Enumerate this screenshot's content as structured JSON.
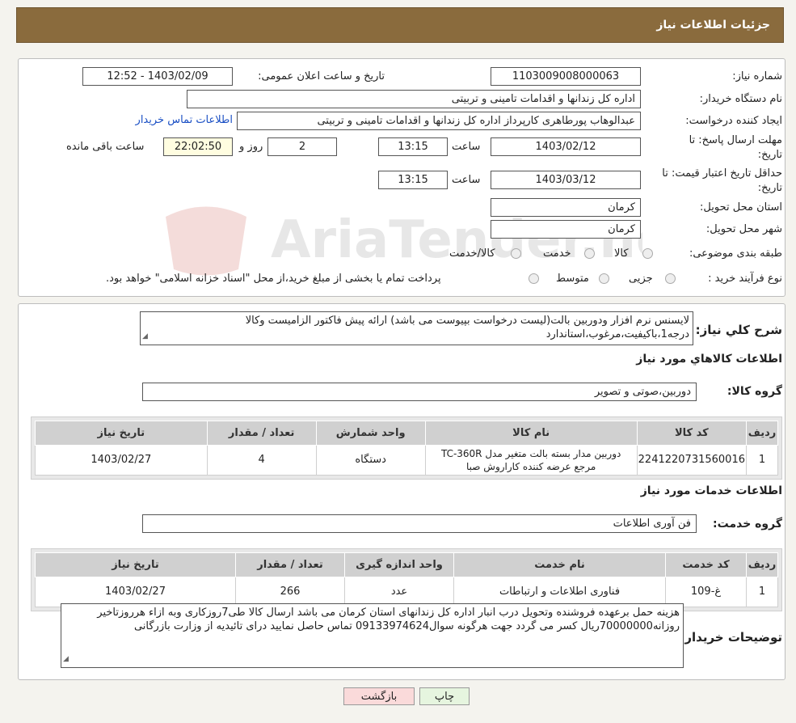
{
  "header": {
    "title": "جزئیات اطلاعات نیاز"
  },
  "form": {
    "need_number_label": "شماره نیاز:",
    "need_number": "1103009008000063",
    "announce_label": "تاریخ و ساعت اعلان عمومی:",
    "announce_value": "1403/02/09 - 12:52",
    "buyer_org_label": "نام دستگاه خریدار:",
    "buyer_org": "اداره کل زندانها و اقدامات تامینی و تربیتی",
    "creator_label": "ایجاد کننده درخواست:",
    "creator": "عبدالوهاب پورطاهری کارپرداز اداره کل زندانها و اقدامات تامینی و تربیتی",
    "contact_link": "اطلاعات تماس خریدار",
    "deadline_label_1": "مهلت ارسال پاسخ: تا",
    "deadline_label_2": "تاریخ:",
    "deadline_date": "1403/02/12",
    "time_label": "ساعت",
    "deadline_time": "13:15",
    "days_value": "2",
    "days_label": "روز و",
    "remaining_value": "22:02:50",
    "remaining_label": "ساعت باقی مانده",
    "validity_label_1": "حداقل تاریخ اعتبار قیمت: تا",
    "validity_label_2": "تاریخ:",
    "validity_date": "1403/03/12",
    "validity_time": "13:15",
    "province_label": "استان محل تحویل:",
    "province": "کرمان",
    "city_label": "شهر محل تحویل:",
    "city": "کرمان",
    "category_label": "طبقه بندی موضوعی:",
    "category_options": [
      "کالا",
      "خدمت",
      "کالا/خدمت"
    ],
    "purchase_type_label": "نوع فرآیند خرید :",
    "purchase_options": [
      "جزیی",
      "متوسط"
    ],
    "purchase_note": "پرداخت تمام یا بخشی از مبلغ خرید،از محل \"اسناد خزانه اسلامی\" خواهد بود."
  },
  "description": {
    "label": "شرح کلي نياز:",
    "text": "لایسنس نرم افزار ودوربین بالت(لیست درخواست بپیوست می باشد) ارائه پیش فاکتور الزامیست وکالا درجه1،باکیفیت،مرغوب،استاندارد"
  },
  "goods": {
    "section_title": "اطلاعات کالاهاي مورد نياز",
    "group_label": "گروه کالا:",
    "group_value": "دوربین،صوتی و تصویر",
    "headers": [
      "ردیف",
      "کد کالا",
      "نام کالا",
      "واحد شمارش",
      "تعداد / مقدار",
      "تاریخ نیاز"
    ],
    "rows": [
      [
        "1",
        "2241220731560016",
        "دوربین مدار بسته بالت متغیر مدل TC-360R مرجع عرضه کننده کاراروش صبا",
        "دستگاه",
        "4",
        "1403/02/27"
      ]
    ]
  },
  "services": {
    "section_title": "اطلاعات خدمات مورد نياز",
    "group_label": "گروه خدمت:",
    "group_value": "فن آوری اطلاعات",
    "headers": [
      "ردیف",
      "کد خدمت",
      "نام خدمت",
      "واحد اندازه گیری",
      "تعداد / مقدار",
      "تاریخ نیاز"
    ],
    "rows": [
      [
        "1",
        "غ-109",
        "فناوری اطلاعات و ارتباطات",
        "عدد",
        "266",
        "1403/02/27"
      ]
    ]
  },
  "buyer_notes": {
    "label": "توضیحات خریدار:",
    "text": "هزینه حمل برعهده فروشنده وتحویل درب انبار اداره کل زندانهای استان کرمان می باشد ارسال کالا طی7روزکاری وبه ازاء هرروزتاخیر روزانه70000000ریال کسر می گردد جهت هرگونه سوال09133974624 تماس حاصل نمایید درای تائیدیه از وزارت بازرگانی"
  },
  "buttons": {
    "print": "چاپ",
    "back": "بازگشت"
  },
  "watermark": {
    "text": "AriaTender.neT"
  },
  "colors": {
    "header_bg": "#8a6b3d",
    "link": "#1a4fc4",
    "print_bg": "#e6f5df",
    "back_bg": "#fadada",
    "highlight": "#fffde0"
  }
}
